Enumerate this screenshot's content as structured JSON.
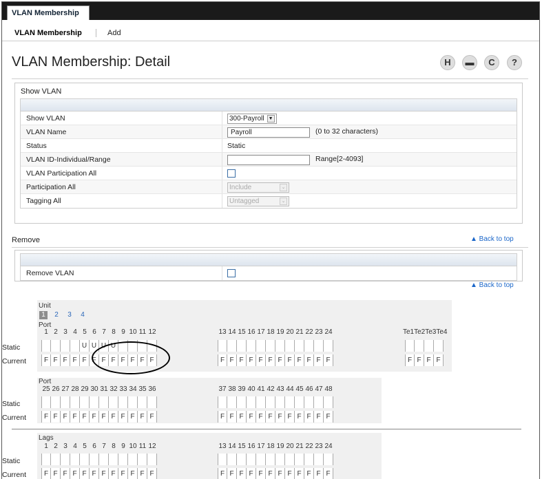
{
  "window": {
    "tab": "VLAN Membership"
  },
  "nav": {
    "active": "VLAN Membership",
    "add": "Add"
  },
  "page": {
    "title": "VLAN Membership: Detail"
  },
  "toolbar": {
    "save": "H",
    "print": "▬",
    "refresh": "C",
    "help": "?"
  },
  "show_vlan": {
    "title": "Show VLAN",
    "rows": {
      "show_vlan": {
        "label": "Show VLAN",
        "value": "300-Payroll"
      },
      "vlan_name": {
        "label": "VLAN Name",
        "value": "Payroll",
        "hint": "(0 to 32 characters)"
      },
      "status": {
        "label": "Status",
        "value": "Static"
      },
      "vlan_id": {
        "label": "VLAN ID-Individual/Range",
        "value": "",
        "hint": "Range[2-4093]"
      },
      "participation_all_vlan": {
        "label": "VLAN Participation All"
      },
      "participation_all": {
        "label": "Participation All",
        "value": "Include"
      },
      "tagging_all": {
        "label": "Tagging All",
        "value": "Untagged"
      }
    }
  },
  "remove": {
    "title": "Remove",
    "back_to_top": "▲ Back to top",
    "row_label": "Remove VLAN"
  },
  "back_to_top_2": "▲ Back to top",
  "port_grid": {
    "unit_label": "Unit",
    "units": [
      "1",
      "2",
      "3",
      "4"
    ],
    "port_label": "Port",
    "lags_label": "Lags",
    "static_label": "Static",
    "current_label": "Current",
    "te_label": "Te1Te2Te3Te4",
    "block1_ports": [
      "1",
      "2",
      "3",
      "4",
      "5",
      "6",
      "7",
      "8",
      "9",
      "10",
      "11",
      "12"
    ],
    "block2_ports": [
      "13",
      "14",
      "15",
      "16",
      "17",
      "18",
      "19",
      "20",
      "21",
      "22",
      "23",
      "24"
    ],
    "block3_ports": [
      "25",
      "26",
      "27",
      "28",
      "29",
      "30",
      "31",
      "32",
      "33",
      "34",
      "35",
      "36"
    ],
    "block4_ports": [
      "37",
      "38",
      "39",
      "40",
      "41",
      "42",
      "43",
      "44",
      "45",
      "46",
      "47",
      "48"
    ],
    "static_unit1": [
      "",
      "",
      "",
      "",
      "U",
      "U",
      "U",
      "U",
      "",
      "",
      "",
      ""
    ],
    "current_value": "F"
  }
}
